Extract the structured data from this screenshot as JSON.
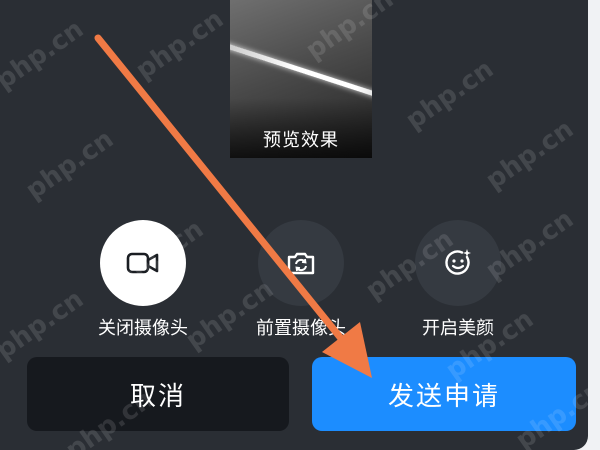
{
  "preview": {
    "label": "预览效果"
  },
  "controls": [
    {
      "label": "关闭摄像头",
      "icon": "video-camera-icon",
      "style": "light"
    },
    {
      "label": "前置摄像头",
      "icon": "camera-flip-icon",
      "style": "dark"
    },
    {
      "label": "开启美颜",
      "icon": "beauty-face-icon",
      "style": "dark"
    }
  ],
  "actions": {
    "cancel_label": "取消",
    "send_label": "发送申请"
  },
  "watermark_text": "php.cn",
  "colors": {
    "background": "#2a2e34",
    "primary_button": "#1c8dff",
    "cancel_button": "#16191e",
    "annotation_arrow": "#f07a45"
  }
}
